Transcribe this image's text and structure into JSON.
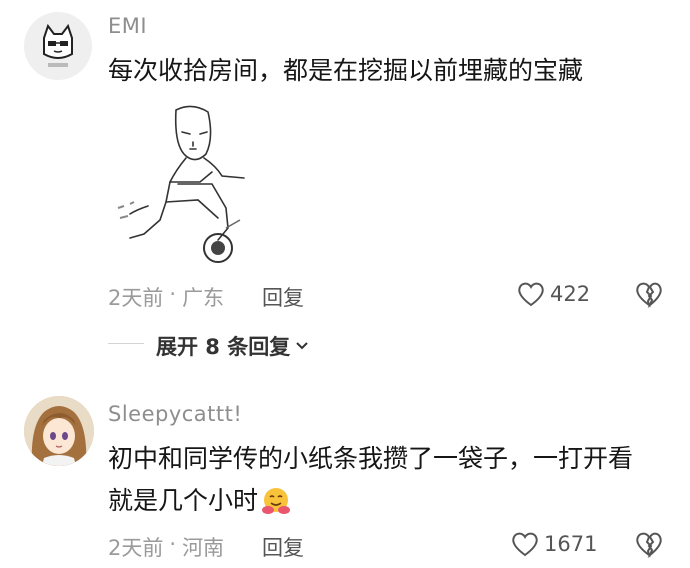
{
  "comments": [
    {
      "username": "EMI",
      "avatar_icon": "cat-face-avatar",
      "text": "每次收拾房间，都是在挖掘以前埋藏的宝藏",
      "image_icon": "sketch-character-on-scooter",
      "time": "2天前",
      "separator": "·",
      "location": "广东",
      "reply_label": "回复",
      "likes": "422",
      "expand_label": "展开 8 条回复"
    },
    {
      "username": "Sleepycattt!",
      "avatar_icon": "anime-girl-avatar",
      "text_line1": "初中和同学传的小纸条我攒了一袋子，一打开看",
      "text_line2": "就是几个小时",
      "emoji_icon": "hugging-face-emoji",
      "time": "2天前",
      "separator": "·",
      "location": "河南",
      "reply_label": "回复",
      "likes": "1671"
    }
  ]
}
